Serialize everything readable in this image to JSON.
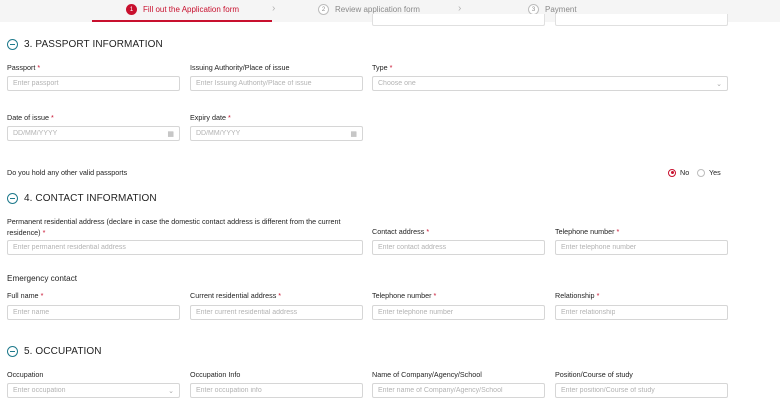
{
  "stepper": {
    "steps": [
      {
        "num": "1",
        "label": "Fill out the Application form"
      },
      {
        "num": "2",
        "label": "Review application form"
      },
      {
        "num": "3",
        "label": "Payment"
      }
    ]
  },
  "passport": {
    "title": "3. PASSPORT INFORMATION",
    "passport_label": "Passport",
    "passport_ph": "Enter passport",
    "authority_label": "Issuing Authority/Place of issue",
    "authority_ph": "Enter Issuing Authority/Place of issue",
    "type_label": "Type",
    "type_ph": "Choose one",
    "issue_label": "Date of issue",
    "issue_ph": "DD/MM/YYYY",
    "expiry_label": "Expiry date",
    "expiry_ph": "DD/MM/YYYY",
    "other_question": "Do you hold any other valid passports",
    "opt_no": "No",
    "opt_yes": "Yes"
  },
  "contact": {
    "title": "4. CONTACT INFORMATION",
    "permanent_label": "Permanent residential address (declare in case the domestic contact address is different from the current residence)",
    "permanent_ph": "Enter permanent residential address",
    "contact_label": "Contact address",
    "contact_ph": "Enter contact address",
    "phone_label": "Telephone number",
    "phone_ph": "Enter telephone number",
    "emergency_title": "Emergency contact",
    "fullname_label": "Full name",
    "fullname_ph": "Enter name",
    "current_label": "Current residential address",
    "current_ph": "Enter current residential address",
    "e_phone_label": "Telephone number",
    "e_phone_ph": "Enter telephone number",
    "relationship_label": "Relationship",
    "relationship_ph": "Enter relationship"
  },
  "occupation": {
    "title": "5. OCCUPATION",
    "occ_label": "Occupation",
    "occ_ph": "Enter occupation",
    "info_label": "Occupation Info",
    "info_ph": "Enter occupation info",
    "company_label": "Name of Company/Agency/School",
    "company_ph": "Enter name of Company/Agency/School",
    "position_label": "Position/Course of study",
    "position_ph": "Enter position/Course of study"
  },
  "required_mark": "*",
  "icons": {
    "calendar": "calendar-icon",
    "chevron": "chevron-down-icon",
    "step_sep": "chevron-right-icon"
  }
}
